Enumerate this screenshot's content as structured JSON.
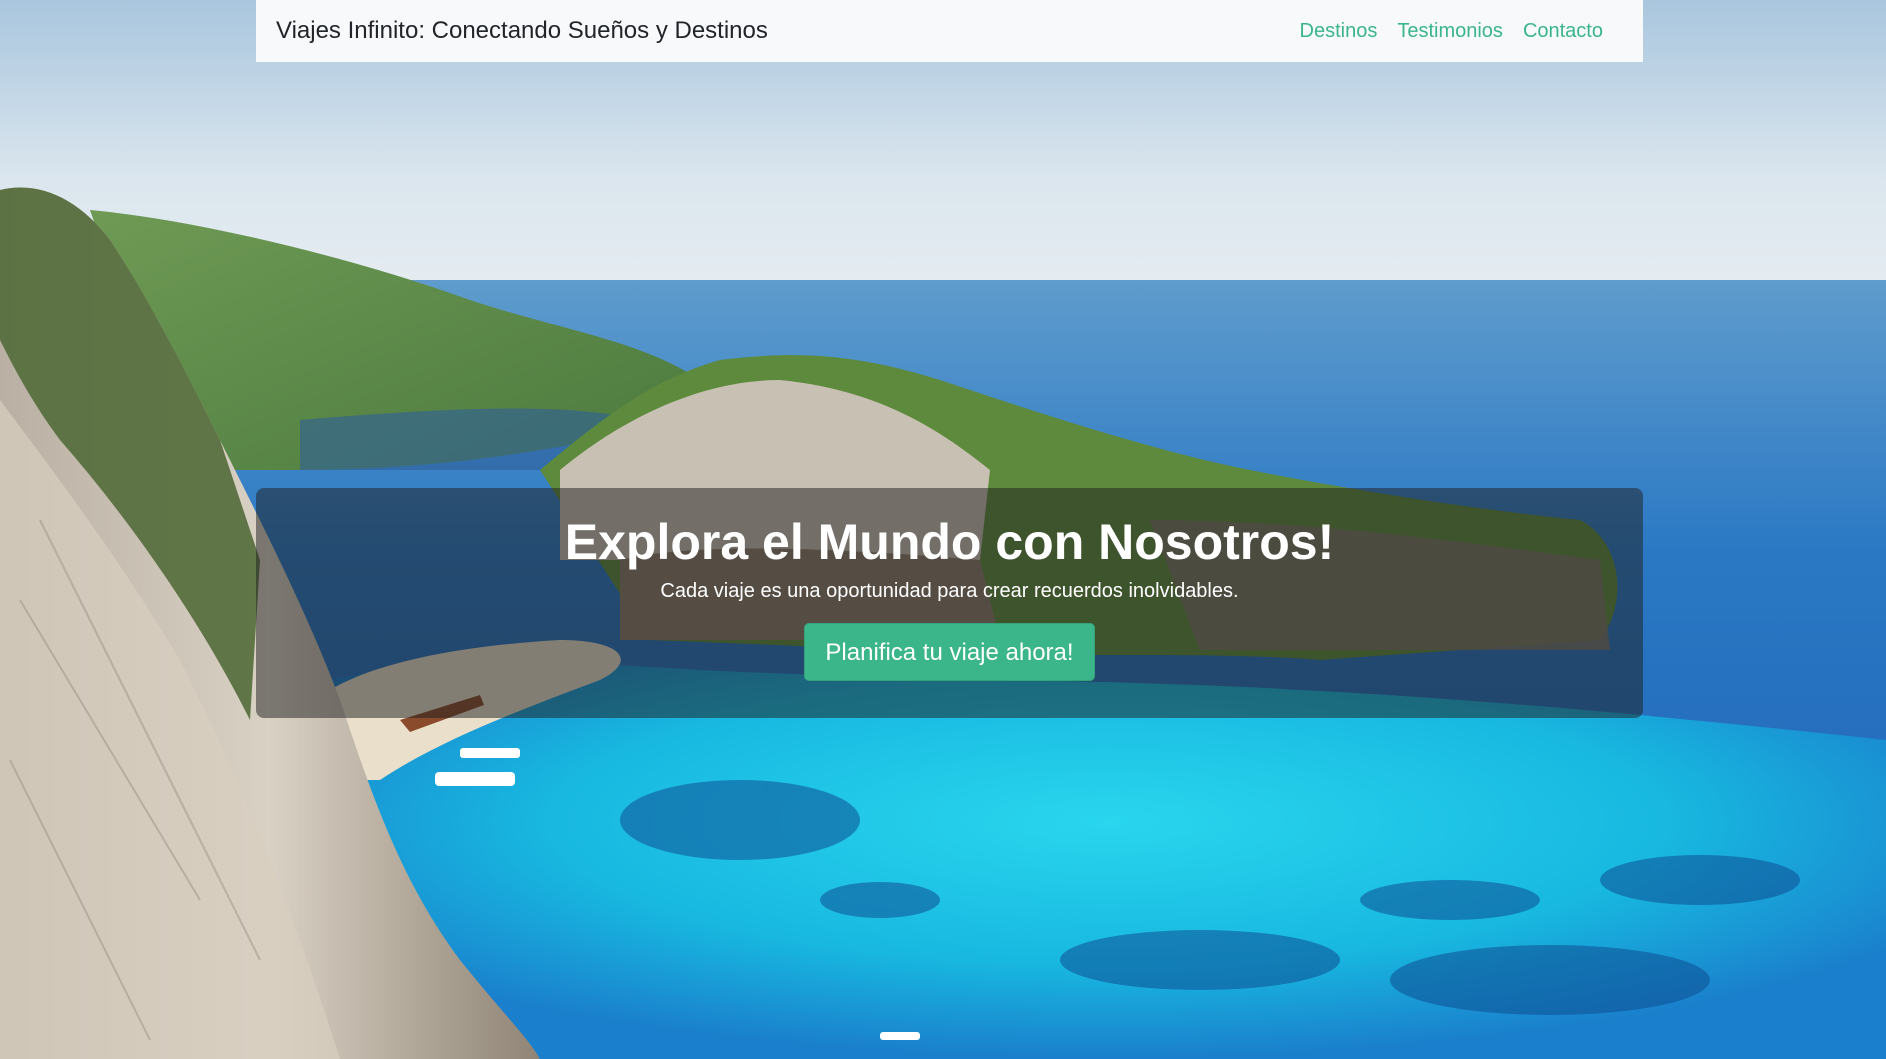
{
  "navbar": {
    "brand": "Viajes Infinito: Conectando Sueños y Destinos",
    "links": [
      "Destinos",
      "Testimonios",
      "Contacto"
    ]
  },
  "hero": {
    "title": "Explora el Mundo con Nosotros!",
    "subtitle": "Cada viaje es una oportunidad para crear recuerdos inolvidables.",
    "button_label": "Planifica tu viaje ahora!",
    "background_icon": "coastal-bay-photo"
  },
  "colors": {
    "accent": "#3bb58a",
    "navbar_bg": "#f8f9fa",
    "overlay": "rgba(30,30,30,0.5)"
  }
}
